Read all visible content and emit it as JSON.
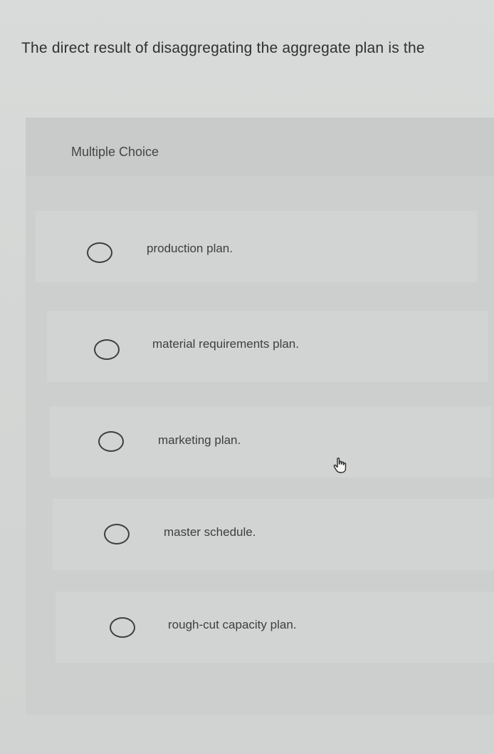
{
  "question": {
    "text": "The direct result of disaggregating the aggregate plan is the"
  },
  "multiple_choice": {
    "title": "Multiple Choice",
    "options": [
      {
        "label": "production plan.",
        "selected": false
      },
      {
        "label": "material requirements plan.",
        "selected": false
      },
      {
        "label": "marketing plan.",
        "selected": false
      },
      {
        "label": "master schedule.",
        "selected": false
      },
      {
        "label": "rough-cut capacity plan.",
        "selected": false
      }
    ]
  },
  "icons": {
    "cursor": "hand-pointer-icon",
    "radio": "radio-circle-icon"
  },
  "colors": {
    "background": "#d3d5d4",
    "panel": "#cdcfce",
    "text": "#2f3030"
  }
}
